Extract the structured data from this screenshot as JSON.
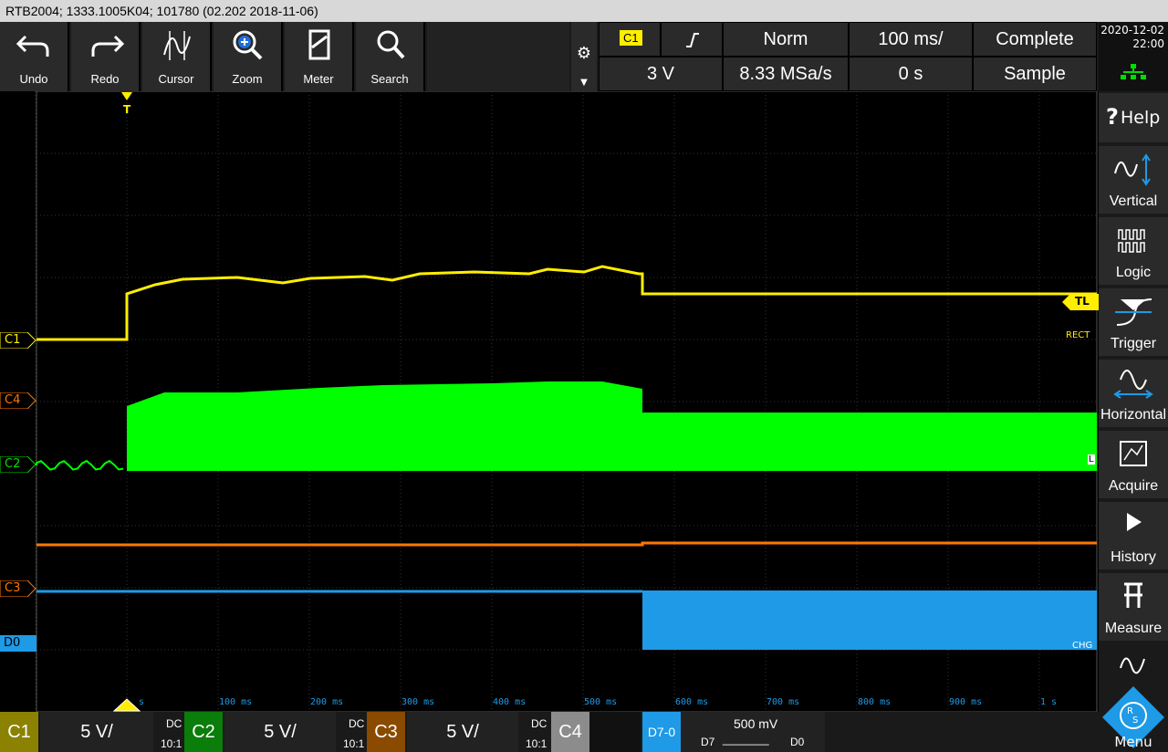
{
  "title": "RTB2004; 1333.1005K04; 101780 (02.202 2018-11-06)",
  "toolbar": {
    "undo": "Undo",
    "redo": "Redo",
    "cursor": "Cursor",
    "zoom": "Zoom",
    "meter": "Meter",
    "search": "Search"
  },
  "trigger_info": {
    "source": "C1",
    "mode": "Norm",
    "timebase": "100 ms/",
    "status": "Complete",
    "level": "3 V",
    "sample_rate": "8.33 MSa/s",
    "offset": "0 s",
    "acq_mode": "Sample"
  },
  "datetime": {
    "date": "2020-12-02",
    "time": "22:00"
  },
  "sidebar": {
    "help": "Help",
    "vertical": "Vertical",
    "logic": "Logic",
    "trigger": "Trigger",
    "horizontal": "Horizontal",
    "acquire": "Acquire",
    "history": "History",
    "measure": "Measure",
    "menu": "Menu"
  },
  "screen": {
    "trigger_marker": "T",
    "tl_marker": "TL",
    "rect_label": "RECT",
    "l_label": "L",
    "chg_label": "CHG",
    "ch_markers": [
      "C1",
      "C4",
      "C2",
      "C3",
      "D0"
    ],
    "time_labels": [
      "s",
      "100 ms",
      "200 ms",
      "300 ms",
      "400 ms",
      "500 ms",
      "600 ms",
      "700 ms",
      "800 ms",
      "900 ms",
      "1 s"
    ]
  },
  "channels": [
    {
      "name": "C1",
      "scale": "5 V/",
      "coupling": "DC",
      "probe": "10:1",
      "color": "#ffee00"
    },
    {
      "name": "C2",
      "scale": "5 V/",
      "coupling": "DC",
      "probe": "10:1",
      "color": "#00dd00"
    },
    {
      "name": "C3",
      "scale": "5 V/",
      "coupling": "DC",
      "probe": "10:1",
      "color": "#ff7700"
    },
    {
      "name": "C4",
      "color": "#999999"
    }
  ],
  "digital": {
    "label": "D7-0",
    "threshold": "500 mV",
    "d7": "D7",
    "d0": "D0",
    "pattern": "_______"
  },
  "colors": {
    "c1": "#ffee00",
    "c2": "#00ff00",
    "c3": "#ff7700",
    "d0": "#1e9ae6"
  }
}
